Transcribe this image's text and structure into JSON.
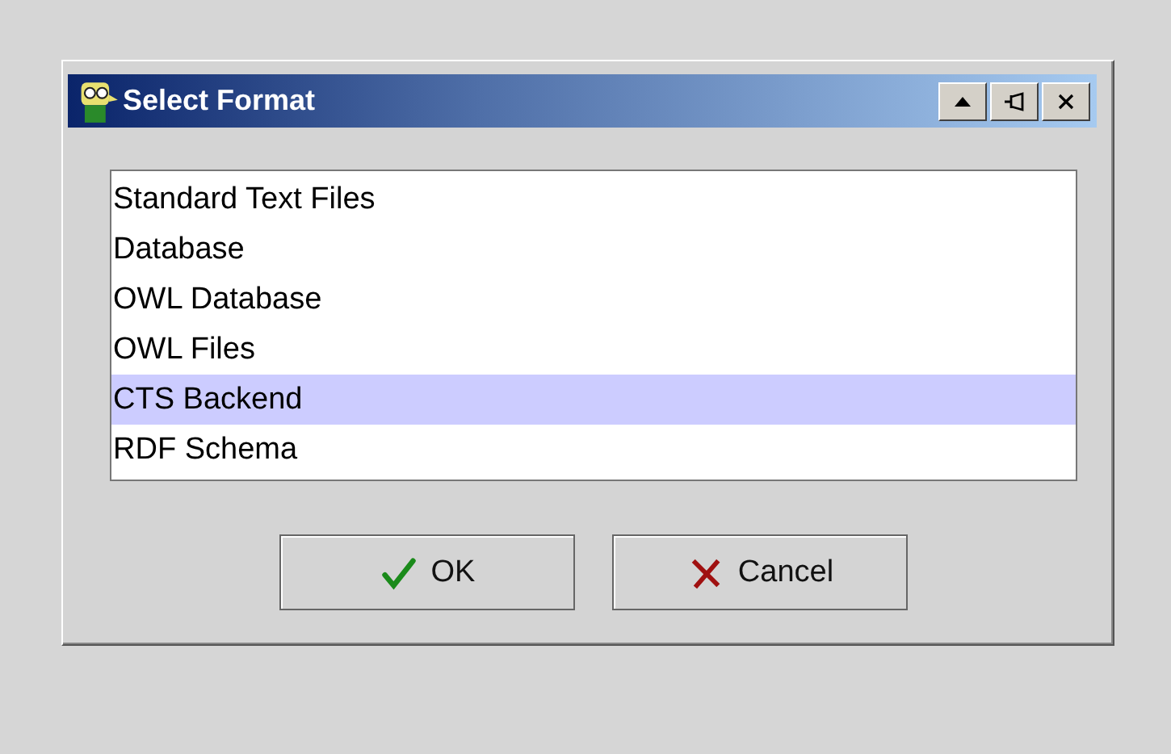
{
  "window": {
    "title": "Select Format",
    "controls": [
      {
        "kind": "minimize"
      },
      {
        "kind": "pin"
      },
      {
        "kind": "close"
      }
    ]
  },
  "list": {
    "items": [
      {
        "label": "Standard Text Files",
        "selected": false
      },
      {
        "label": "Database",
        "selected": false
      },
      {
        "label": "OWL Database",
        "selected": false
      },
      {
        "label": "OWL Files",
        "selected": false
      },
      {
        "label": "CTS Backend",
        "selected": true
      },
      {
        "label": "RDF Schema",
        "selected": false
      }
    ]
  },
  "buttons": [
    {
      "kind": "ok",
      "label": "OK"
    },
    {
      "kind": "cancel",
      "label": "Cancel"
    }
  ]
}
